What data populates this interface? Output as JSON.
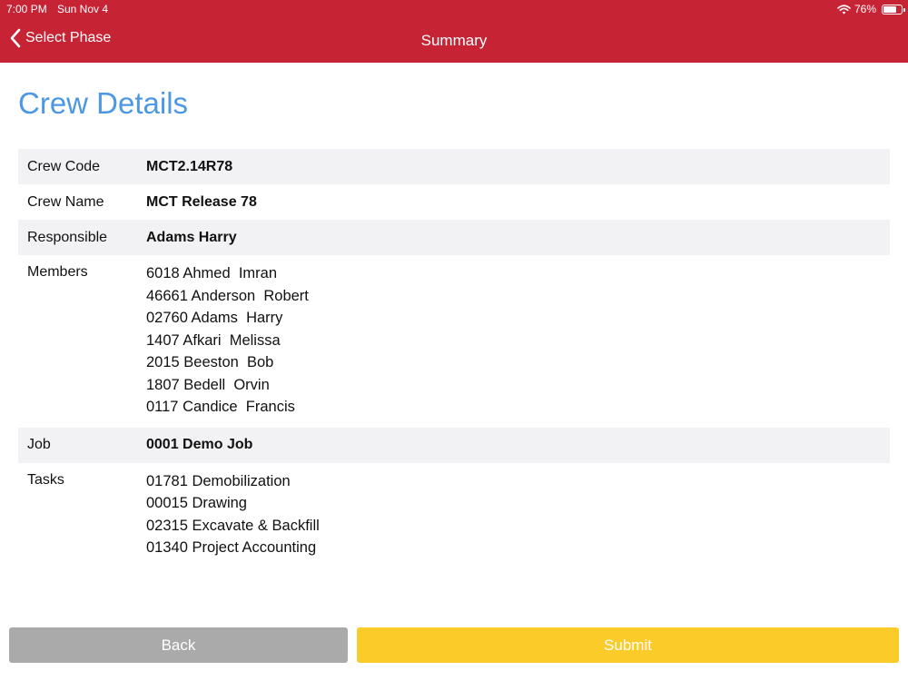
{
  "status_bar": {
    "time": "7:00 PM",
    "date": "Sun Nov 4",
    "battery_text": "76%",
    "battery_level": 0.76
  },
  "nav": {
    "back_label": "Select Phase",
    "title": "Summary"
  },
  "page_title": "Crew Details",
  "details": {
    "crew_code": {
      "label": "Crew Code",
      "value": "MCT2.14R78"
    },
    "crew_name": {
      "label": "Crew Name",
      "value": "MCT Release 78"
    },
    "responsible": {
      "label": "Responsible",
      "value": "Adams  Harry"
    },
    "members": {
      "label": "Members",
      "items": [
        "6018 Ahmed  Imran",
        "46661 Anderson  Robert",
        "02760 Adams  Harry",
        "1407 Afkari  Melissa",
        "2015 Beeston  Bob",
        "1807 Bedell  Orvin",
        "0117 Candice  Francis"
      ]
    },
    "job": {
      "label": "Job",
      "value": "0001 Demo Job"
    },
    "tasks": {
      "label": "Tasks",
      "items": [
        "01781 Demobilization",
        "00015 Drawing",
        "02315 Excavate & Backfill",
        "01340 Project Accounting"
      ]
    }
  },
  "buttons": {
    "back_label": "Back",
    "submit_label": "Submit"
  },
  "colors": {
    "header": "#c62334",
    "title": "#4c98e4",
    "back_button": "#aaaaaa",
    "submit_button": "#fbcb2a"
  }
}
